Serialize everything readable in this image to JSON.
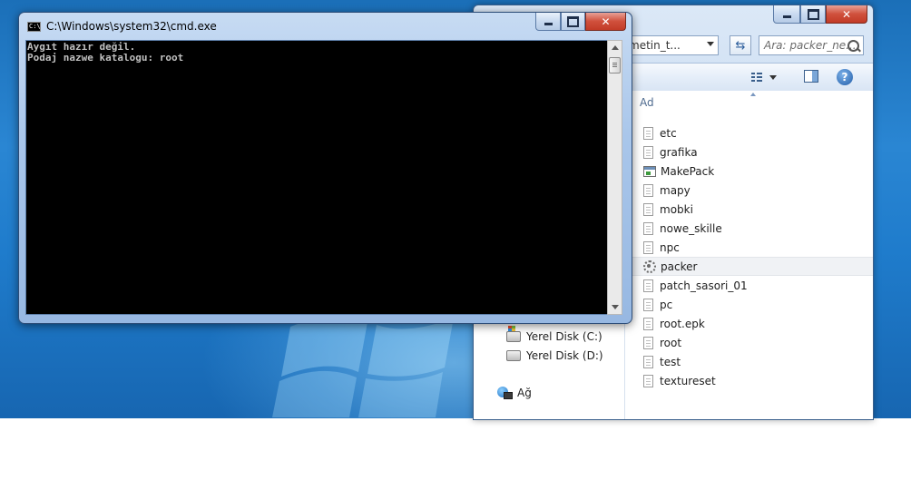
{
  "cmd": {
    "title": "C:\\Windows\\system32\\cmd.exe",
    "icon_label": "C:\\",
    "console_lines": [
      "Aygıt hazır değil.",
      "Podaj nazwe katalogu: root"
    ]
  },
  "explorer": {
    "address": "metin_t...",
    "search_placeholder": "Ara: packer_ne...",
    "column_header": "Ad",
    "files": [
      {
        "name": "etc",
        "icon": "file-icon"
      },
      {
        "name": "grafika",
        "icon": "file-icon"
      },
      {
        "name": "MakePack",
        "icon": "app-icon"
      },
      {
        "name": "mapy",
        "icon": "file-icon"
      },
      {
        "name": "mobki",
        "icon": "file-icon"
      },
      {
        "name": "nowe_skille",
        "icon": "file-icon"
      },
      {
        "name": "npc",
        "icon": "file-icon"
      },
      {
        "name": "packer",
        "icon": "gear-file-icon",
        "selected": true
      },
      {
        "name": "patch_sasori_01",
        "icon": "file-icon"
      },
      {
        "name": "pc",
        "icon": "file-icon"
      },
      {
        "name": "root.epk",
        "icon": "file-icon"
      },
      {
        "name": "root",
        "icon": "file-icon"
      },
      {
        "name": "test",
        "icon": "file-icon"
      },
      {
        "name": "textureset",
        "icon": "file-icon"
      }
    ],
    "nav": {
      "drive_c": "Yerel Disk (C:)",
      "drive_d": "Yerel Disk (D:)",
      "network": "Ağ"
    }
  }
}
